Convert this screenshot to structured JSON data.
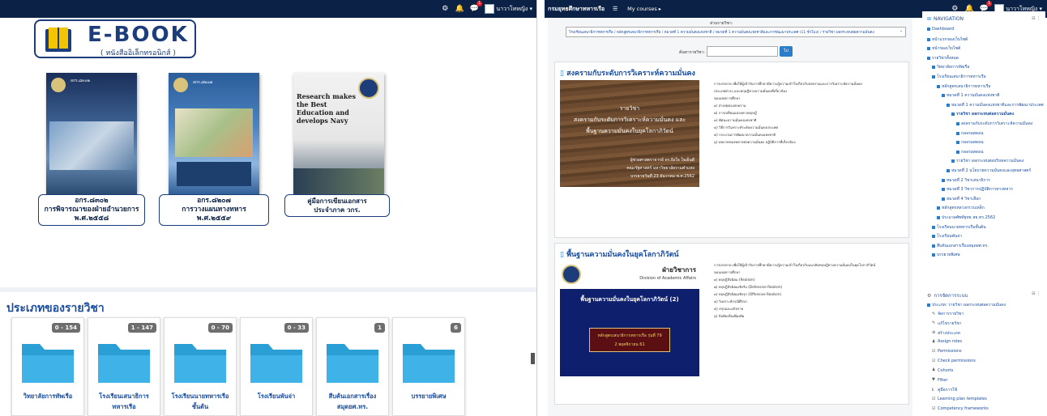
{
  "left": {
    "topbar": {
      "user": "นาวาโทหญิง ▾",
      "notif_count": "1"
    },
    "logo": {
      "title": "E-BOOK",
      "subtitle": "( หนังสืออิเล็กทรอนิกส์ )"
    },
    "books": [
      {
        "caption1": "อกร.๘๓๐๒",
        "caption2": "การพิจารณาของฝ่ายอำนวยการ",
        "caption3": "พ.ศ.๒๕๕๘",
        "cover_top": "อกร.๘๓๐๒"
      },
      {
        "caption1": "อกร.๘๒๐๗",
        "caption2": "การวางแผนทางทหาร",
        "caption3": "พ.ศ.๒๕๕๙",
        "cover_top": "อกร.๘๒๐๗"
      },
      {
        "caption1": "คู่มือการเขียนเอกสาร",
        "caption2": "ประจำภาค วกร.",
        "caption3": "",
        "cover_title": "Research makes the Best Education and develops Navy"
      }
    ],
    "categories_title": "ประเภทของรายวิชา",
    "categories": [
      {
        "count": "0 - 154",
        "name": "วิทยาลัยการทัพเรือ",
        "name2": ""
      },
      {
        "count": "1 - 147",
        "name": "โรงเรียนเสนาธิการ",
        "name2": "ทหารเรือ"
      },
      {
        "count": "0 - 70",
        "name": "โรงเรียนนายทหารเรือ",
        "name2": "ชั้นต้น"
      },
      {
        "count": "0 - 33",
        "name": "โรงเรียนพันจ่า",
        "name2": ""
      },
      {
        "count": "1",
        "name": "สืบค้นเอกสารเรื่อง",
        "name2": "สมุดยศ.ทร."
      },
      {
        "count": "6",
        "name": "บรรยายพิเศษ",
        "name2": ""
      }
    ]
  },
  "right": {
    "topbar": {
      "brand": "กรมยุทธศึกษาทหารเรือ",
      "mycourses": "My courses ▸",
      "user": "นาวาโทหญิง ▾",
      "notif_count": "1"
    },
    "course_nav_label": "ส่วนรายวิชา:",
    "course_select": "โรงเรียนเสนาธิการทหารเรือ / หลักสูตรเสนาธิการทหารเรือ / หมวดที่ 1 ความมั่นคงแห่งชาติ / หมวดที่ 1 ความมั่นคงแห่งชาติและการพัฒนาประเทศ (11 ชั่วโมง) / รายวิชา ผลกระทบต่อความมั่นคง",
    "search_label": "ค้นหารายวิชา:",
    "search_button": "ไป",
    "sections": [
      {
        "title": "สงครามกับระดับการวิเคราะห์ความมั่นคง",
        "img_lines": [
          "รายวิชา",
          "สงครามกับระดับการวิเคราะห์ความมั่นคง และ",
          "พื้นฐานความมั่นคงในยุคโลกาภิวัตน์"
        ],
        "img_footer": [
          "ผู้ช่วยศาสตราจารย์ ดร.ยิ่งใจ ใจเย็นดี",
          "คณะรัฐศาสตร์ มหาวิทยาลัยรามคำแหง",
          "บรรยายวันที่ 23 ธันวาคม พ.ศ.2562"
        ],
        "desc": [
          "การบรรยาย เพื่อให้ผู้เข้ารับการศึกษามีความรู้ความเข้าใจเกี่ยวกับสงครามและการวิเคราะห์ความมั่นคง",
          "ประเภทต่างๆ และทฤษฎีทางความมั่นคงที่เกี่ยวข้อง",
          "ขอบเขตการศึกษา",
          "๑) สาเหตุของสงคราม",
          "๒) การเปลี่ยนแปลงทางทฤษฎี",
          "๓) ทัศนะความมั่นคงแห่งชาติ",
          "๔) วิธีการวิเคราะห์ระดับความมั่นคงประเทศ",
          "๕) กระบวนการพัฒนาความมั่นคงแห่งชาติ",
          "๖) บทบาทของทหารต่อความมั่นคง ปฏิบัติการที่เกี่ยวข้อง"
        ]
      },
      {
        "title": "พื้นฐานความมั่นคงในยุคโลกาภิวัตน์",
        "img_head": "ฝ่ายวิชาการ",
        "img_sub": "Division of Academic Affairs",
        "img_main": "พื้นฐานความมั่นคงในยุคโลกาภิวัตน์ (2)",
        "img_box1": "หลักสูตรเสนาธิการทหารเรือ รุ่นที่ 79",
        "img_box2": "2 พฤศจิกายน 61",
        "desc": [
          "การบรรยาย เพื่อให้ผู้เข้ารับการศึกษามีความรู้ความเข้าใจเกี่ยวกับแนวคิดทฤษฎีทางความมั่นคงในยุคโลกาภิวัตน์",
          "ขอบเขตการศึกษา",
          "๑) ทฤษฎีสัจนิยม (Realism)",
          "๒) ทฤษฎีสัจนิยมเชิงรับ (Defensive Realism)",
          "๓) ทฤษฎีสัจนิยมเชิงรุก (Offensive Realism)",
          "๔) วิเคราะห์กรณีศึกษา",
          "๕) สรุปและอภิปราย",
          "๖) ข้อคิดเห็นเพิ่มเติม"
        ]
      }
    ],
    "navigation": {
      "title": "NAVIGATION",
      "items": [
        {
          "label": "Dashboard",
          "indent": 0,
          "bold": false
        },
        {
          "label": "หน้าแรกของเว็บไซต์",
          "indent": 0,
          "bold": false
        },
        {
          "label": "หน้าของเว็บไซต์",
          "indent": 0,
          "bold": false
        },
        {
          "label": "รายวิชาทั้งหมด",
          "indent": 0,
          "bold": false
        },
        {
          "label": "วิทยาลัยการทัพเรือ",
          "indent": 1,
          "bold": false
        },
        {
          "label": "โรงเรียนเสนาธิการทหารเรือ",
          "indent": 1,
          "bold": false
        },
        {
          "label": "หลักสูตรเสนาธิการทหารเรือ",
          "indent": 2,
          "bold": false
        },
        {
          "label": "หมวดที่ 1 ความมั่นคงแห่งชาติ",
          "indent": 3,
          "bold": false
        },
        {
          "label": "หมวดที่ 1 ความมั่นคงแห่งชาติและการพัฒนาประเทศ",
          "indent": 4,
          "bold": false
        },
        {
          "label": "รายวิชา ผลกระทบต่อความมั่นคง",
          "indent": 5,
          "bold": true
        },
        {
          "label": "สงครามกับระดับการวิเคราะห์ความมั่นคง",
          "indent": 6,
          "bold": false
        },
        {
          "label": "กลอรอสดอน",
          "indent": 6,
          "bold": false
        },
        {
          "label": "กลอรอสดอน",
          "indent": 6,
          "bold": false
        },
        {
          "label": "กลอรอสดอน",
          "indent": 6,
          "bold": false
        },
        {
          "label": "รายวิชา ผลกระทบต่อบริบทความมั่นคง",
          "indent": 5,
          "bold": false
        },
        {
          "label": "หมวดที่ 2 นโยบายความมั่นคงและยุทธศาสตร์",
          "indent": 4,
          "bold": false
        },
        {
          "label": "หมวดที่ 2 วิชาเสนาธิการ",
          "indent": 3,
          "bold": false
        },
        {
          "label": "หมวดที่ 3 วิชาการปฏิบัติการทางทหาร",
          "indent": 3,
          "bold": false
        },
        {
          "label": "หมวดที่ 4 วิชาเลือก",
          "indent": 3,
          "bold": false
        },
        {
          "label": "หลักสูตรหลวงกรวบเหล็ก",
          "indent": 2,
          "bold": false
        },
        {
          "label": "ประมวลศัพท์ยุทธ สธ.ทร.2562",
          "indent": 2,
          "bold": false
        },
        {
          "label": "โรงเรียนนายทหารเรือชั้นต้น",
          "indent": 1,
          "bold": false
        },
        {
          "label": "โรงเรียนพันจ่า",
          "indent": 1,
          "bold": false
        },
        {
          "label": "สืบค้นเอกสารเรื่องสมุดยศ.ทร.",
          "indent": 1,
          "bold": false
        },
        {
          "label": "บรรยายพิเศษ",
          "indent": 1,
          "bold": false
        }
      ]
    },
    "admin": {
      "title": "การจัดการระบบ",
      "course_item": "ประเภท: รายวิชา ผลกระทบต่อความมั่นคง",
      "items": [
        "จัดการรายวิชา",
        "แก้ไขรายวิชา",
        "สร้างประเภท",
        "Assign roles",
        "Permissions",
        "Check permissions",
        "Cohorts",
        "Filter",
        "คู่มือการใช้",
        "Learning plan templates",
        "Competency frameworks"
      ]
    }
  }
}
